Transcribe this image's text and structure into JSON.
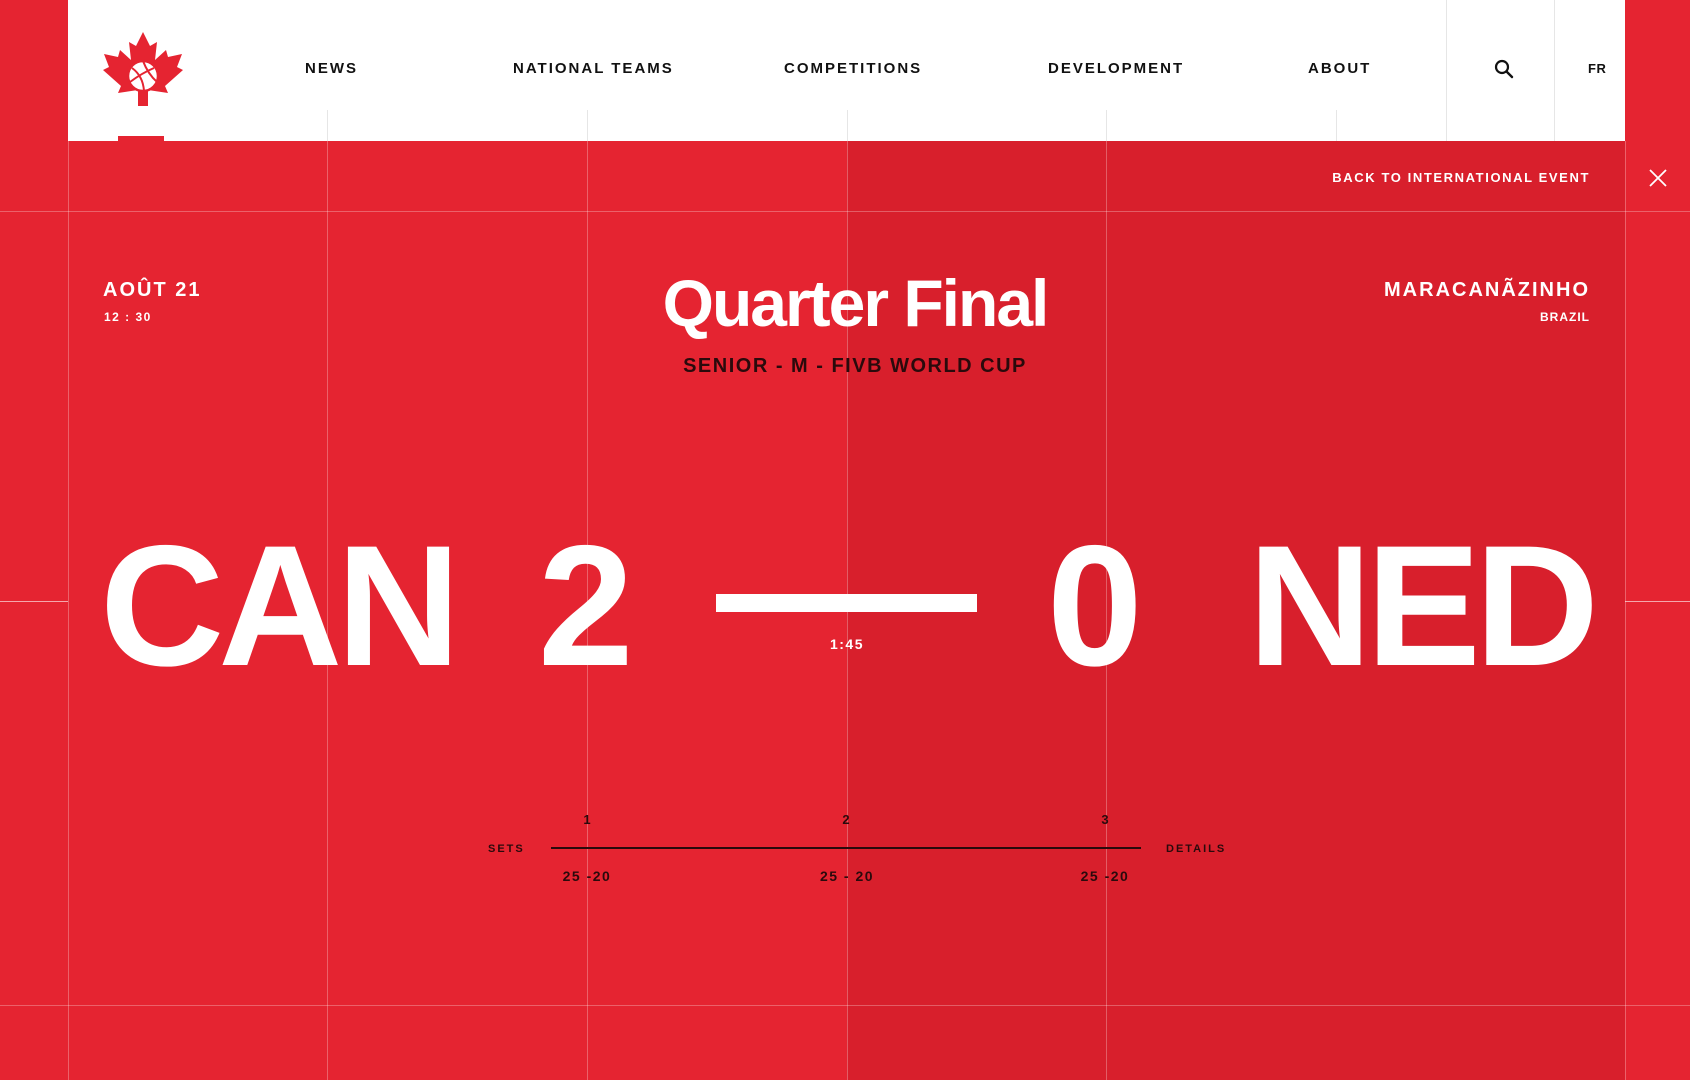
{
  "nav": {
    "items": [
      {
        "label": "NEWS"
      },
      {
        "label": "NATIONAL TEAMS"
      },
      {
        "label": "COMPETITIONS"
      },
      {
        "label": "DEVELOPMENT"
      },
      {
        "label": "ABOUT"
      }
    ],
    "lang": "FR",
    "search_icon": "search-icon",
    "logo_icon": "maple-leaf-volleyball-logo"
  },
  "back_link": "BACK TO INTERNATIONAL EVENT",
  "close_icon": "close-icon",
  "match": {
    "date": "AOÛT 21",
    "time": "12 : 30",
    "venue": "MARACANÃZINHO",
    "country": "BRAZIL",
    "round": "Quarter Final",
    "competition": "SENIOR - M - FIVB WORLD CUP",
    "home_team": "CAN",
    "home_score": "2",
    "away_score": "0",
    "away_team": "NED",
    "duration": "1:45"
  },
  "sets": {
    "label": "SETS",
    "details_label": "DETAILS",
    "items": [
      {
        "num": "1",
        "score": "25 -20"
      },
      {
        "num": "2",
        "score": "25 - 20"
      },
      {
        "num": "3",
        "score": "25 -20"
      }
    ]
  },
  "colors": {
    "primary_red": "#e52431",
    "dark_red": "#d81f2c",
    "text_dark": "#2a0a0c",
    "white": "#ffffff"
  }
}
